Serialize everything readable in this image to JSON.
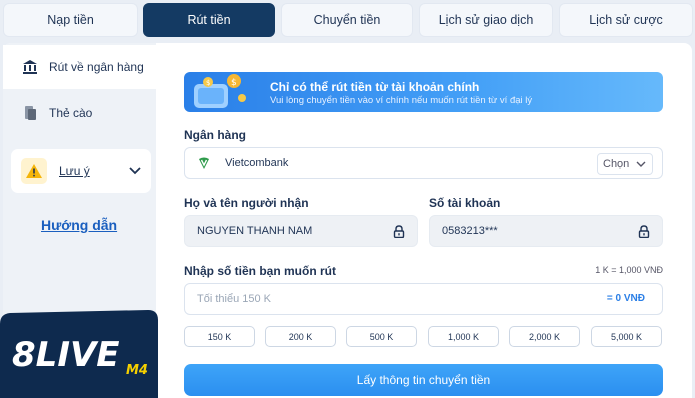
{
  "tabs": [
    {
      "label": "Nạp tiền",
      "active": false
    },
    {
      "label": "Rút tiền",
      "active": true
    },
    {
      "label": "Chuyển tiền",
      "active": false
    },
    {
      "label": "Lịch sử giao dịch",
      "active": false
    },
    {
      "label": "Lịch sử cược",
      "active": false
    }
  ],
  "sidebar": {
    "items": [
      {
        "label": "Rút về ngân hàng",
        "icon": "bank-icon",
        "active": true
      },
      {
        "label": "Thẻ cào",
        "icon": "card-icon",
        "active": false
      }
    ],
    "note_label": "Lưu ý",
    "guide_label": "Hướng dẫn"
  },
  "logo": {
    "text": "8LIVE",
    "suffix": "M4"
  },
  "banner": {
    "title": "Chỉ có thể rút tiền từ tài khoản chính",
    "subtitle": "Vui lòng chuyển tiền vào ví chính nếu muốn rút tiền từ ví đại lý"
  },
  "bank": {
    "label": "Ngân hàng",
    "name": "Vietcombank",
    "choose_label": "Chọn"
  },
  "recipient": {
    "label": "Họ và tên người nhận",
    "value": "NGUYEN THANH NAM"
  },
  "account": {
    "label": "Số tài khoản",
    "value": "0583213***"
  },
  "amount": {
    "label": "Nhập số tiền bạn muốn rút",
    "rate": "1 K = 1,000 VNĐ",
    "placeholder": "Tối thiểu 150 K",
    "equivalent": "= 0 VNĐ",
    "quick_options": [
      "150 K",
      "200 K",
      "500 K",
      "1,000 K",
      "2,000 K",
      "5,000 K"
    ]
  },
  "submit_label": "Lấy thông tin chuyển tiền",
  "colors": {
    "primary_dark": "#143a63",
    "accent": "#2b8ff0",
    "link": "#1a5fbf",
    "warning": "#f5b50a"
  }
}
